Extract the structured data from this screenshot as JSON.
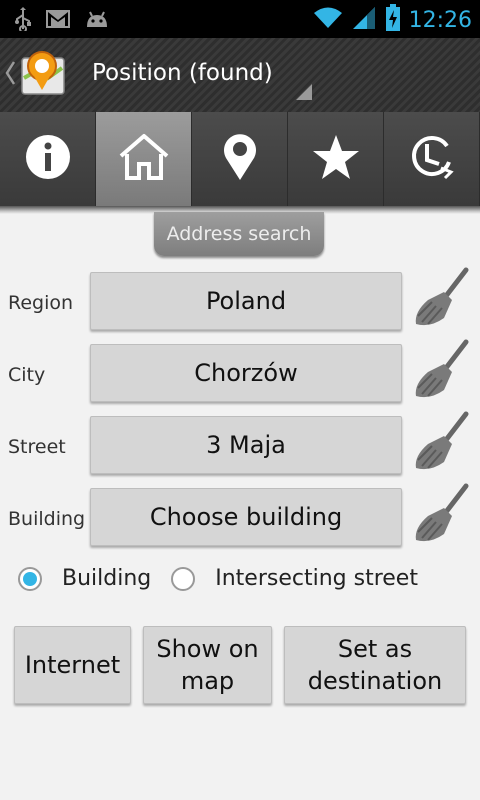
{
  "status_bar": {
    "time": "12:26",
    "left_icons": [
      "usb-icon",
      "gmail-icon",
      "android-debug-icon"
    ],
    "right_icons": [
      "wifi-icon",
      "signal-icon",
      "battery-charging-icon"
    ],
    "accent_color": "#33b5e5"
  },
  "action_bar": {
    "title": "Position (found)",
    "up_icon": "chevron-left-icon",
    "app_icon": "map-marker-app-icon"
  },
  "tabs": [
    {
      "icon": "info-icon",
      "active": false
    },
    {
      "icon": "home-icon",
      "active": true
    },
    {
      "icon": "location-pin-icon",
      "active": false
    },
    {
      "icon": "star-icon",
      "active": false
    },
    {
      "icon": "history-icon",
      "active": false
    }
  ],
  "section_title": "Address search",
  "fields": [
    {
      "label": "Region",
      "value": "Poland"
    },
    {
      "label": "City",
      "value": "Chorzów"
    },
    {
      "label": "Street",
      "value": "3 Maja"
    },
    {
      "label": "Building",
      "value": "Choose building"
    }
  ],
  "radio_options": [
    {
      "label": "Building",
      "selected": true
    },
    {
      "label": "Intersecting street",
      "selected": false
    }
  ],
  "buttons": {
    "internet": "Internet",
    "show_on_map_line1": "Show on",
    "show_on_map_line2": "map",
    "set_destination_line1": "Set as",
    "set_destination_line2": "destination"
  }
}
